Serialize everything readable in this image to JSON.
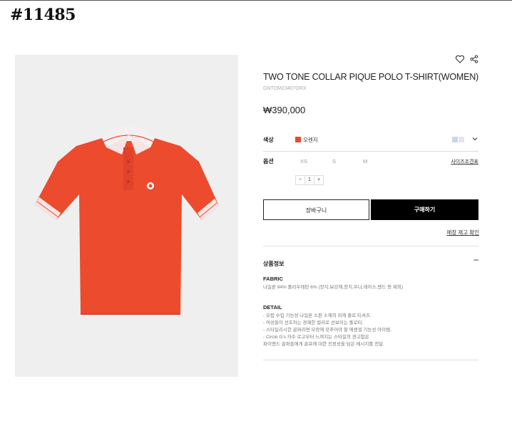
{
  "post_id": "#11485",
  "product": {
    "title": "TWO TONE COLLAR PIQUE POLO T-SHIRT(WOMEN)",
    "code": "GNTOM23407ORX",
    "price": "₩390,000"
  },
  "options": {
    "color_label": "색상",
    "color_value": "오렌지",
    "color_swatch": "#e84a2c",
    "thumb_colors": [
      "#c8d6ee",
      "#e6e6e6"
    ],
    "size_label": "옵션",
    "sizes": [
      "XS",
      "S",
      "M"
    ],
    "size_guide": "사이즈조견표",
    "quantity": "1",
    "minus": "−",
    "plus": "+"
  },
  "actions": {
    "cart": "장바구니",
    "buy": "구매하기",
    "stock_check": "매장 재고 확인"
  },
  "info": {
    "title": "상품정보",
    "fabric_title": "FABRIC",
    "fabric_text": "나일론 94% 폴리우레탄 6% (장지,보강재,장치,우나,레이스,밴드 등 제외)",
    "detail_title": "DETAIL",
    "detail_lines": [
      "- 유럽 수입 기능성 나일론 스판 소재의 피케 폴로 티셔츠.",
      "- 여성들이 선호하는 경쾌한 컬러로 선보이는 폴로티.",
      "- 스타일리시한 골퍼라면 모장에 갖추어야 할 에센셜 기능성 아이템.",
      "- Circle G's 자수 로고부터 느껴지는 스타일의 견고함은",
      "  파이앤드 골퍼들에게 골프에 대한 진정성을 담은 메시지를 전달."
    ]
  },
  "icons": {
    "wishlist": "heart-icon",
    "share": "share-icon",
    "dropdown": "chevron-down-icon"
  }
}
